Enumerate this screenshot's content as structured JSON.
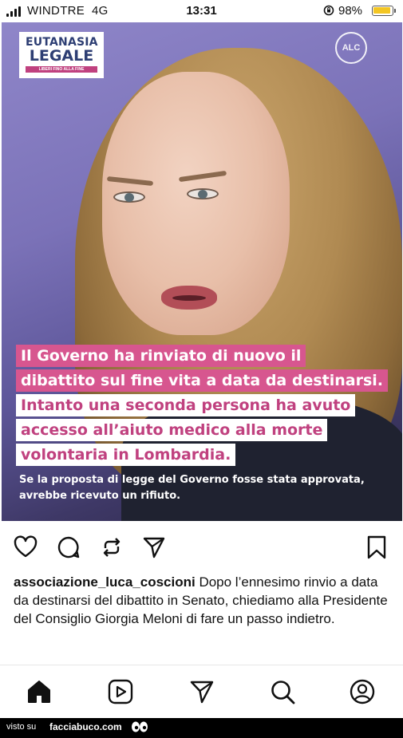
{
  "status_bar": {
    "carrier": "WINDTRE",
    "network": "4G",
    "time": "13:31",
    "battery_percent": "98%",
    "battery_level": 0.98,
    "battery_color": "#f3c623"
  },
  "post_image": {
    "logo": {
      "line1": "EUTANASIA",
      "line2": "LEGALE",
      "tagline": "LIBERI FINO ALLA FINE"
    },
    "badge": "ALC",
    "caption_lines": [
      "Il Governo ha rinviato di nuovo il",
      "dibattito sul fine vita a data da destinarsi.",
      "Intanto una seconda persona ha avuto",
      "accesso all’aiuto medico alla morte",
      "volontaria in Lombardia."
    ],
    "subcaption": "Se la proposta di legge del Governo fosse stata approvata, avrebbe ricevuto un rifiuto.",
    "accent_pink": "#d7568f",
    "accent_blue": "#2d3e73"
  },
  "actions": {
    "like_icon": "heart-icon",
    "comment_icon": "comment-icon",
    "repost_icon": "repost-icon",
    "share_icon": "send-icon",
    "save_icon": "bookmark-icon"
  },
  "post": {
    "username": "associazione_luca_coscioni",
    "text": " Dopo l’ennesimo rinvio a data da destinarsi del dibattito in Senato, chiediamo alla Presidente del Consiglio Giorgia Meloni di fare un passo indietro.",
    "more_indicator": "."
  },
  "nav": [
    "home-icon",
    "reels-icon",
    "send-icon",
    "search-icon",
    "profile-icon"
  ],
  "footer": {
    "prefix": "visto su",
    "site": "facciabuco.com"
  }
}
